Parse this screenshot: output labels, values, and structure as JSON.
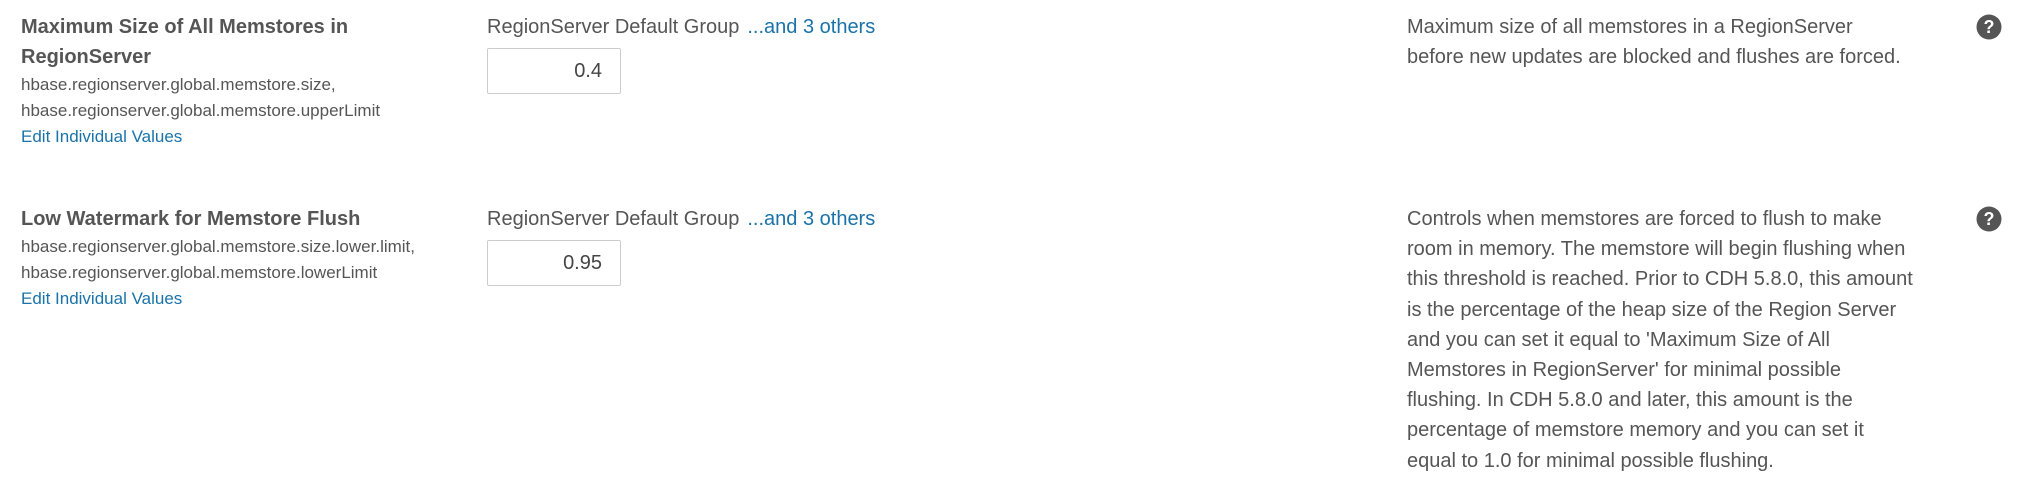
{
  "rows": [
    {
      "title_line1": "Maximum Size of All Memstores in",
      "title_line2": "RegionServer",
      "key_line1": "hbase.regionserver.global.memstore.size,",
      "key_line2": "hbase.regionserver.global.memstore.upperLimit",
      "edit_link": "Edit Individual Values",
      "group_label": "RegionServer Default Group",
      "others_link": "...and 3 others",
      "value": "0.4",
      "description_lines": [
        "Maximum size of all memstores in a RegionServer",
        "before new updates are blocked and flushes are forced."
      ],
      "help_icon": "question-circle-icon"
    },
    {
      "title_line1": "Low Watermark for Memstore Flush",
      "key_line1": "hbase.regionserver.global.memstore.size.lower.limit,",
      "key_line2": "hbase.regionserver.global.memstore.lowerLimit",
      "edit_link": "Edit Individual Values",
      "group_label": "RegionServer Default Group",
      "others_link": "...and 3 others",
      "value": "0.95",
      "description_lines": [
        "Controls when memstores are forced to flush to make",
        "room in memory. The memstore will begin flushing when",
        "this threshold is reached. Prior to CDH 5.8.0, this amount",
        "is the percentage of the heap size of the Region Server",
        "and you can set it equal to 'Maximum Size of All",
        "Memstores in RegionServer' for minimal possible",
        "flushing. In CDH 5.8.0 and later, this amount is the",
        "percentage of memstore memory and you can set it",
        "equal to 1.0 for minimal possible flushing."
      ],
      "help_icon": "question-circle-icon"
    }
  ],
  "colors": {
    "link": "#1a73a8",
    "text": "#555555",
    "icon": "#555555"
  }
}
